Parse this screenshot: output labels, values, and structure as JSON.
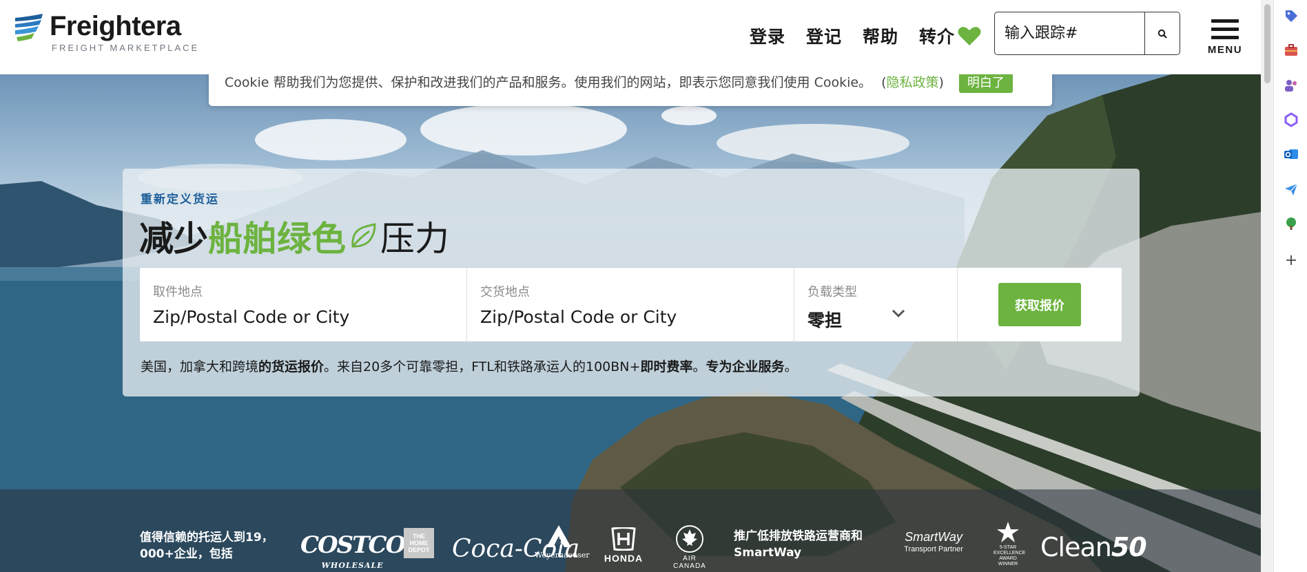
{
  "brand": {
    "name": "Freightera",
    "tagline": "FREIGHT MARKETPLACE"
  },
  "nav": {
    "login": "登录",
    "register": "登记",
    "help": "帮助",
    "refer": "转介",
    "tracking_placeholder": "输入跟踪#",
    "menu_label": "MENU"
  },
  "cookie": {
    "text": "Cookie 帮助我们为您提供、保护和改进我们的产品和服务。使用我们的网站，即表示您同意我们使用 Cookie。",
    "paren_open": "(",
    "privacy_link": "隐私政策",
    "paren_close": ")",
    "accept_button": "明白了"
  },
  "hero": {
    "eyebrow": "重新定义货运",
    "headline_part1": "减少",
    "headline_part2": "船舶绿色",
    "headline_part3": "压力",
    "form": {
      "pickup_label": "取件地点",
      "pickup_placeholder": "Zip/Postal Code or City",
      "dropoff_label": "交货地点",
      "dropoff_placeholder": "Zip/Postal Code or City",
      "load_label": "负载类型",
      "load_value": "零担",
      "submit_button": "获取报价"
    },
    "tagline": {
      "t1": "美国，加拿大和跨境",
      "t2": "的货运报价",
      "t3": "。来自20多个可靠零担，FTL和铁路承运人的100BN+",
      "t4": "即时费率",
      "t5": "。",
      "t6": "专为企业服务",
      "t7": "。"
    }
  },
  "trusted": {
    "text": "值得信赖的托运人到19，000+企业，包括",
    "rail_text": "推广低排放铁路运营商和SmartWay",
    "logos": {
      "costco": "COSTCO",
      "costco_sub": "WHOLESALE",
      "homedepot": "THE HOME DEPOT",
      "cocacola": "Coca-Cola",
      "weyerhaeuser": "Weyerhaeuser",
      "honda": "HONDA",
      "aircanada": "AIR CANADA",
      "smartway": "SmartWay",
      "smartway_sub": "Transport Partner",
      "fivestar": "5-STAR EXCELLENCE AWARD WINNER",
      "clean50_a": "Clean",
      "clean50_b": "50"
    }
  },
  "colors": {
    "brand_green": "#6cb33f",
    "brand_blue": "#1d5f9a"
  }
}
